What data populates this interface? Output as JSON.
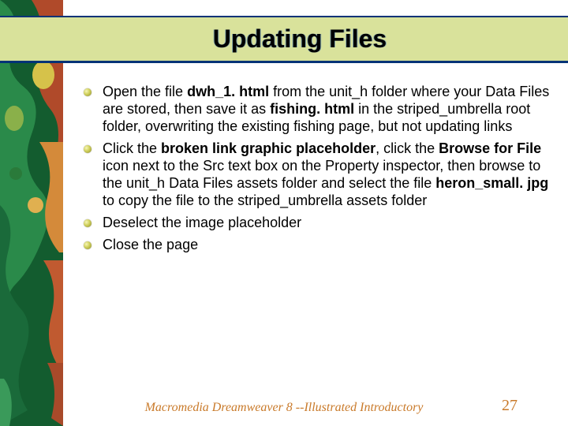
{
  "title": "Updating Files",
  "bullets": [
    {
      "pre1": "Open the file ",
      "bold1": "dwh_1. html",
      "mid1": " from the unit_h folder where your Data Files are stored, then save it as ",
      "bold2": "fishing. html",
      "post": " in the striped_umbrella root folder, overwriting the existing fishing page, but not updating links"
    },
    {
      "pre1": "Click the ",
      "bold1": "broken link graphic placeholder",
      "mid1": ", click the ",
      "bold2": "Browse for File",
      "mid2": " icon next to the Src text box on the Property inspector, then browse to the unit_h Data Files assets folder and select the file ",
      "bold3": "heron_small. jpg",
      "post": " to copy the file to the striped_umbrella assets folder"
    },
    {
      "plain": "Deselect the image placeholder"
    },
    {
      "plain": "Close the page"
    }
  ],
  "footer": "Macromedia Dreamweaver 8 --Illustrated Introductory",
  "page_number": "27"
}
